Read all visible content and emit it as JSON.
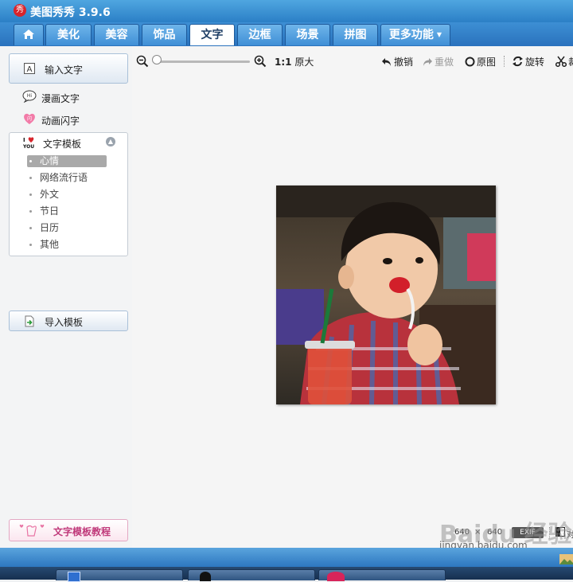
{
  "app": {
    "logo_glyph": "秀",
    "title": "美图秀秀 3.9.6"
  },
  "tabs": [
    {
      "label": "美化"
    },
    {
      "label": "美容"
    },
    {
      "label": "饰品"
    },
    {
      "label": "文字"
    },
    {
      "label": "边框"
    },
    {
      "label": "场景"
    },
    {
      "label": "拼图"
    },
    {
      "label": "更多功能"
    }
  ],
  "active_tab": "文字",
  "sidebar": {
    "input_text": "输入文字",
    "comic_text": "漫画文字",
    "animated_text": "动画闪字",
    "template_header": "文字模板",
    "template_icon_text": "I ♥ YOU",
    "template_items": [
      "心情",
      "网络流行语",
      "外文",
      "节日",
      "日历",
      "其他"
    ],
    "selected_template": "心情",
    "import_template": "导入模板",
    "tutorial": "文字模板教程"
  },
  "toolbar": {
    "ratio_label": "1:1",
    "original_size": "原大",
    "undo": "撤销",
    "redo": "重做",
    "original": "原图",
    "rotate": "旋转",
    "crop": "裁"
  },
  "zoom_level": 0.0,
  "status": {
    "width": "640",
    "times": "×",
    "height": "640",
    "exif": "EXIF",
    "truncated_label": "对"
  },
  "watermark": {
    "brand": "Baidu 经验",
    "url": "jingyan.baidu.com"
  },
  "colors": {
    "title_bar": "#2b7fc6",
    "active_tab_bg": "#ffffff",
    "tutorial_pink": "#c0397a"
  },
  "icons": [
    "home-icon",
    "text-a-icon",
    "speech-bubble-icon",
    "heart-flash-icon",
    "i-love-you-icon",
    "collapse-up-icon",
    "import-icon",
    "zoom-out-icon",
    "zoom-in-icon",
    "undo-icon",
    "redo-icon",
    "circle-icon",
    "rotate-icon",
    "scissors-icon",
    "compare-icon"
  ]
}
